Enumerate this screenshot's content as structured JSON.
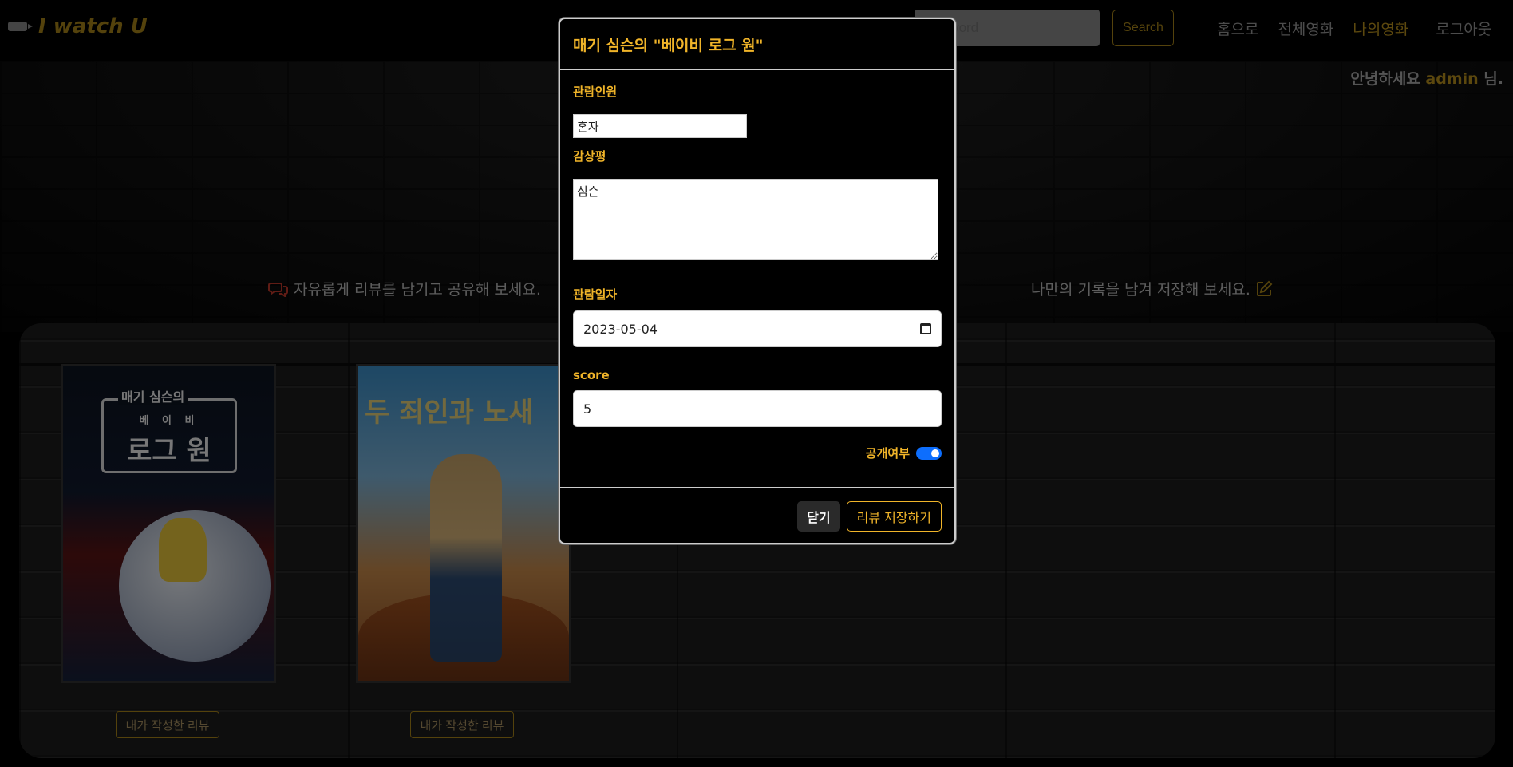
{
  "navbar": {
    "logo_text": "I watch U",
    "search_placeholder": "Keyword",
    "search_button": "Search",
    "links": [
      "홈으로",
      "전체영화",
      "나의영화",
      "로그아웃"
    ],
    "greeting_prefix": "안녕하세요",
    "greeting_user": "admin",
    "greeting_suffix": "님."
  },
  "taglines": {
    "left": "자유롭게 리뷰를 남기고 공유해 보세요.",
    "right": "나만의 기록을 남겨 저장해 보세요."
  },
  "posters": [
    {
      "title_top": "매기 심슨의",
      "title_small": "베 이 비",
      "title_main": "로그 원",
      "button": "내가 작성한 리뷰"
    },
    {
      "title_main": "두 죄인과 노새",
      "button": "내가 작성한 리뷰"
    }
  ],
  "modal": {
    "title": "매기 심슨의 \"베이비 로그 원\"",
    "viewers_label": "관람인원",
    "viewers_value": "혼자",
    "review_label": "감상평",
    "review_value": "심슨",
    "date_label": "관람일자",
    "date_value": "2023-05-04",
    "score_label": "score",
    "score_value": "5",
    "public_label": "공개여부",
    "public_checked": true,
    "close_button": "닫기",
    "save_button": "리뷰 저장하기"
  },
  "colors": {
    "accent": "#f0b429",
    "brand": "#a88518",
    "toggle": "#0d6efd",
    "chat_icon": "#c0392b"
  }
}
